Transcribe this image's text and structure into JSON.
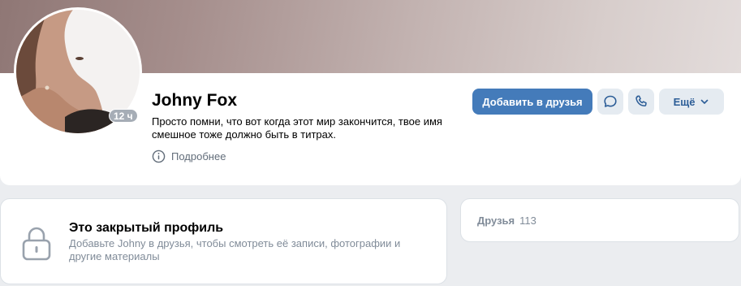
{
  "profile": {
    "name": "Johny Fox",
    "status_line": "Просто помни, что вот когда этот мир закончится, твое имя смешное тоже должно быть в титрах.",
    "last_seen": "12 ч",
    "more_info_label": "Подробнее"
  },
  "actions": {
    "add_friend_label": "Добавить в друзья",
    "more_label": "Ещё"
  },
  "closed_profile": {
    "title": "Это закрытый профиль",
    "text": "Добавьте Johny в друзья, чтобы смотреть её записи, фотографии и другие материалы"
  },
  "friends": {
    "label": "Друзья",
    "count": "113"
  },
  "colors": {
    "accent": "#447bba",
    "secondary_button": "#e5ebf1",
    "muted_text": "#818c99"
  },
  "icons": [
    "info-icon",
    "message-icon",
    "phone-icon",
    "chevron-down-icon",
    "lock-icon"
  ]
}
